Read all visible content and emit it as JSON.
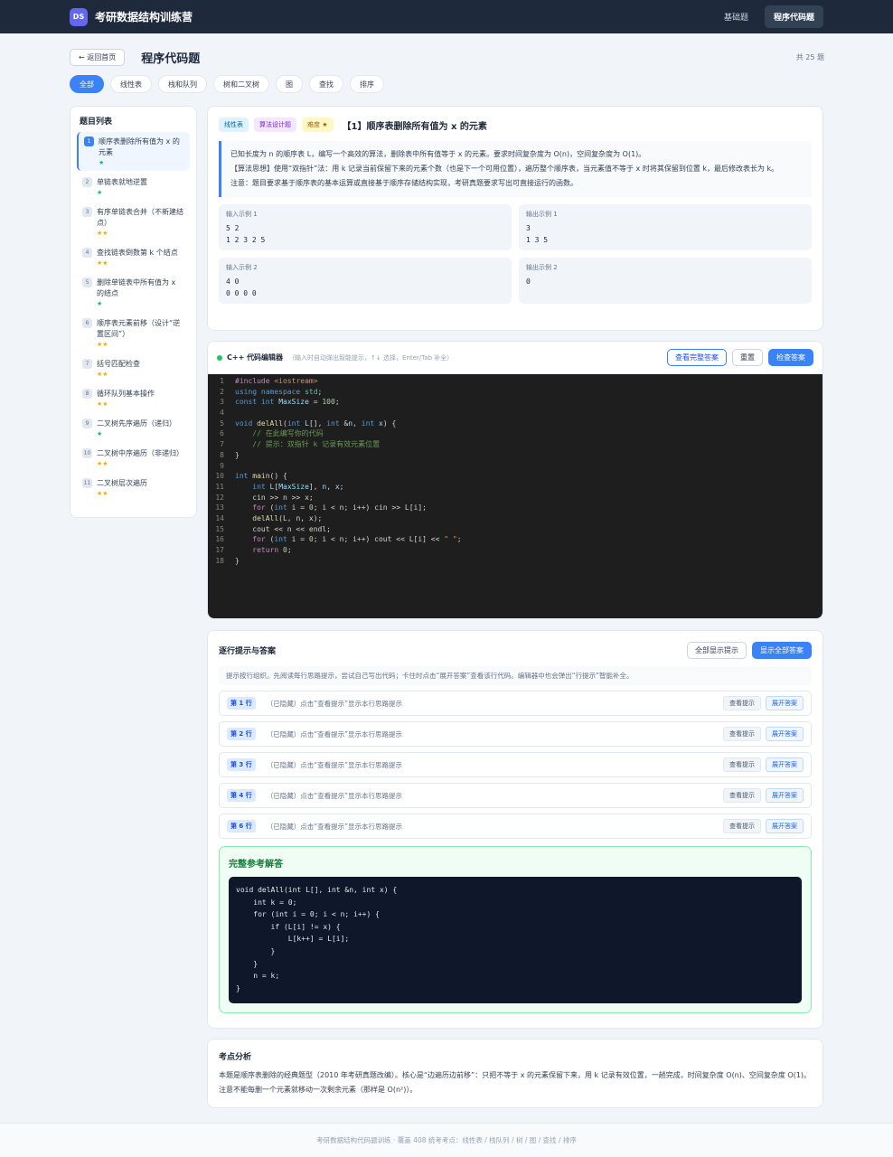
{
  "app": {
    "logo": "DS",
    "title": "考研数据结构训练营"
  },
  "nav": [
    "基础题",
    "程序代码题"
  ],
  "header": {
    "back": "← 返回首页",
    "title": "程序代码题",
    "count": "共 25 题"
  },
  "filters": [
    "全部",
    "线性表",
    "栈和队列",
    "树和二叉树",
    "图",
    "查找",
    "排序"
  ],
  "sidebar": {
    "title": "题目列表",
    "items": [
      {
        "num": "1",
        "name": "顺序表删除所有值为 x 的元素",
        "stars": "★"
      },
      {
        "num": "2",
        "name": "单链表就地逆置",
        "stars": "★"
      },
      {
        "num": "3",
        "name": "有序单链表合并（不新建结点）",
        "stars": "★★"
      },
      {
        "num": "4",
        "name": "查找链表倒数第 k 个结点",
        "stars": "★★"
      },
      {
        "num": "5",
        "name": "删除单链表中所有值为 x 的结点",
        "stars": "★"
      },
      {
        "num": "6",
        "name": "顺序表元素前移（设计“逆置区间”）",
        "stars": "★★"
      },
      {
        "num": "7",
        "name": "括号匹配检查",
        "stars": "★★"
      },
      {
        "num": "8",
        "name": "循环队列基本操作",
        "stars": "★★"
      },
      {
        "num": "9",
        "name": "二叉树先序遍历（递归）",
        "stars": "★"
      },
      {
        "num": "10",
        "name": "二叉树中序遍历（非递归）",
        "stars": "★★"
      },
      {
        "num": "11",
        "name": "二叉树层次遍历",
        "stars": "★★"
      }
    ]
  },
  "question": {
    "tags": [
      "线性表",
      "算法设计题",
      "难度 ★"
    ],
    "title": "【1】顺序表删除所有值为 x 的元素",
    "desc": [
      "已知长度为 n 的顺序表 L，编写一个高效的算法，删除表中所有值等于 x 的元素。要求时间复杂度为 O(n)，空间复杂度为 O(1)。",
      "【算法思想】使用“双指针”法：用 k 记录当前保留下来的元素个数（也是下一个可用位置），遍历整个顺序表，当元素值不等于 x 时将其保留到位置 k，最后修改表长为 k。",
      "注意：题目要求基于顺序表的基本运算或直接基于顺序存储结构实现，考研真题要求写出可直接运行的函数。"
    ],
    "samples": [
      {
        "label": "输入示例 1",
        "value": "5 2\n1 2 3 2 5"
      },
      {
        "label": "输出示例 1",
        "value": "3\n1 3 5"
      },
      {
        "label": "输入示例 2",
        "value": "4 0\n0 0 0 0"
      },
      {
        "label": "输出示例 2",
        "value": "0"
      }
    ]
  },
  "editor": {
    "title": "C++ 代码编辑器",
    "hint": "（输入时自动弹出智能提示，↑↓ 选择，Enter/Tab 补全）",
    "buttons": [
      "查看完整答案",
      "重置",
      "检查答案"
    ],
    "lines": [
      "#include <iostream>",
      "using namespace std;",
      "const int MaxSize = 100;",
      "",
      "void delAll(int L[], int &n, int x) {",
      "    // 在此编写你的代码",
      "    // 提示：双指针 k 记录有效元素位置",
      "}",
      "",
      "int main() {",
      "    int L[MaxSize], n, x;",
      "    cin >> n >> x;",
      "    for (int i = 0; i < n; i++) cin >> L[i];",
      "    delAll(L, n, x);",
      "    cout << n << endl;",
      "    for (int i = 0; i < n; i++) cout << L[i] << \" \";",
      "    return 0;",
      "}"
    ]
  },
  "hints": {
    "title": "逐行提示与答案",
    "buttons": [
      "全部显示提示",
      "显示全部答案"
    ],
    "desc": "提示按行组织。先阅读每行思路提示，尝试自己写出代码；卡住时点击“展开答案”查看该行代码。编辑器中也会弹出“行提示”智能补全。",
    "rows": [
      {
        "line": "第 1 行",
        "text": "（已隐藏）点击“查看提示”显示本行思路提示"
      },
      {
        "line": "第 2 行",
        "text": "（已隐藏）点击“查看提示”显示本行思路提示"
      },
      {
        "line": "第 3 行",
        "text": "（已隐藏）点击“查看提示”显示本行思路提示"
      },
      {
        "line": "第 4 行",
        "text": "（已隐藏）点击“查看提示”显示本行思路提示"
      },
      {
        "line": "第 6 行",
        "text": "（已隐藏）点击“查看提示”显示本行思路提示"
      }
    ],
    "row_btns": [
      "查看提示",
      "展开答案"
    ],
    "answer_title": "完整参考解答",
    "answer_lines": [
      "void delAll(int L[], int &n, int x) {",
      "    int k = 0;",
      "    for (int i = 0; i < n; i++) {",
      "        if (L[i] != x) {",
      "            L[k++] = L[i];",
      "        }",
      "    }",
      "    n = k;",
      "}"
    ]
  },
  "analysis": {
    "title": "考点分析",
    "text": "本题是顺序表删除的经典题型（2010 年考研真题改编）。核心是“边遍历边前移”：只把不等于 x 的元素保留下来，用 k 记录有效位置，一趟完成，时间复杂度 O(n)、空间复杂度 O(1)。注意不能每删一个元素就移动一次剩余元素（那样是 O(n²)）。"
  },
  "footer": "考研数据结构代码题训练 · 覆盖 408 统考考点：线性表 / 栈队列 / 树 / 图 / 查找 / 排序"
}
